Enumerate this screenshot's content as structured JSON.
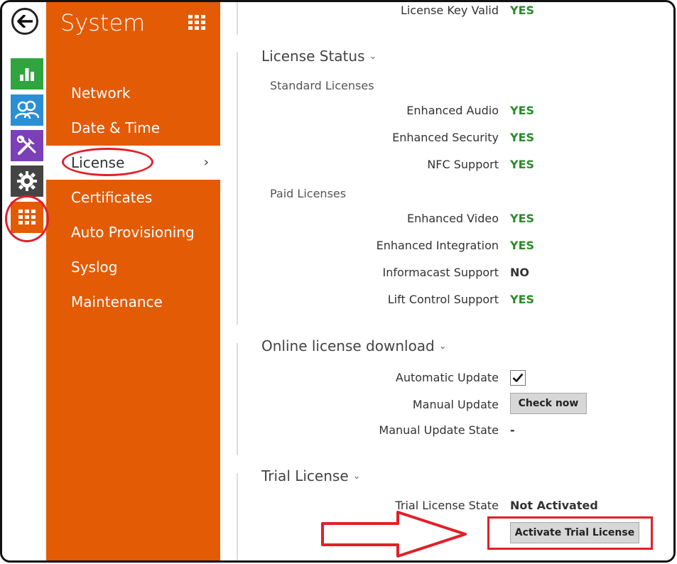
{
  "sidebar": {
    "title": "System",
    "items": [
      {
        "label": "Network"
      },
      {
        "label": "Date & Time"
      },
      {
        "label": "License"
      },
      {
        "label": "Certificates"
      },
      {
        "label": "Auto Provisioning"
      },
      {
        "label": "Syslog"
      },
      {
        "label": "Maintenance"
      }
    ],
    "active_chevron": "›"
  },
  "top_row": {
    "label": "License Key Valid",
    "value": "YES"
  },
  "license_status": {
    "title": "License Status",
    "standard_title": "Standard Licenses",
    "standard": [
      {
        "label": "Enhanced Audio",
        "value": "YES"
      },
      {
        "label": "Enhanced Security",
        "value": "YES"
      },
      {
        "label": "NFC Support",
        "value": "YES"
      }
    ],
    "paid_title": "Paid Licenses",
    "paid": [
      {
        "label": "Enhanced Video",
        "value": "YES"
      },
      {
        "label": "Enhanced Integration",
        "value": "YES"
      },
      {
        "label": "Informacast Support",
        "value": "NO"
      },
      {
        "label": "Lift Control Support",
        "value": "YES"
      }
    ]
  },
  "online_download": {
    "title": "Online license download",
    "automatic_update_label": "Automatic Update",
    "automatic_update_checked": true,
    "manual_update_label": "Manual Update",
    "check_now_label": "Check now",
    "manual_state_label": "Manual Update State",
    "manual_state_value": "-"
  },
  "trial": {
    "title": "Trial License",
    "state_label": "Trial License State",
    "state_value": "Not Activated",
    "activate_label": "Activate Trial License"
  },
  "colors": {
    "accent": "#e35b05",
    "yes": "#2a8a2a",
    "highlight": "#e0202a"
  },
  "icons": [
    "back-arrow-icon",
    "dashboard-chart-icon",
    "directory-users-icon",
    "hardware-tools-icon",
    "services-gear-icon",
    "system-grid-icon"
  ]
}
